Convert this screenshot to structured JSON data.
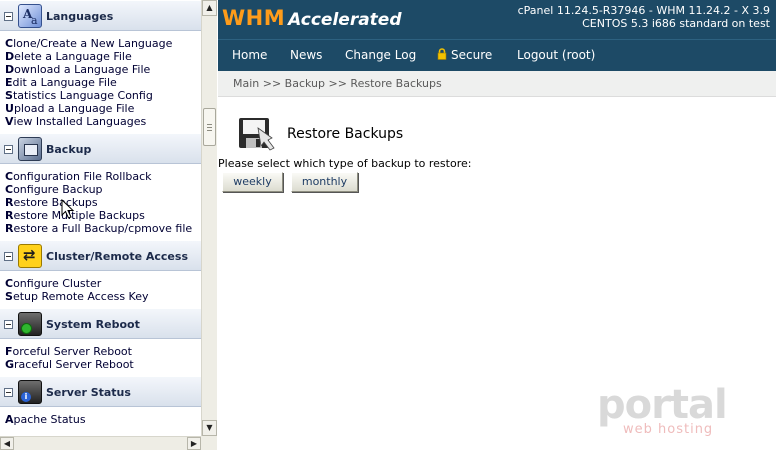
{
  "sidebar": {
    "sections": [
      {
        "title": "Languages",
        "icon": "language-icon",
        "links": [
          "Clone/Create a New Language",
          "Delete a Language File",
          "Download a Language File",
          "Edit a Language File",
          "Statistics Language Config",
          "Upload a Language File",
          "View Installed Languages"
        ]
      },
      {
        "title": "Backup",
        "icon": "backup-icon",
        "links": [
          "Configuration File Rollback",
          "Configure Backup",
          "Restore Backups",
          "Restore Multiple Backups",
          "Restore a Full Backup/cpmove file"
        ]
      },
      {
        "title": "Cluster/Remote Access",
        "icon": "cluster-icon",
        "links": [
          "Configure Cluster",
          "Setup Remote Access Key"
        ]
      },
      {
        "title": "System Reboot",
        "icon": "reboot-icon",
        "links": [
          "Forceful Server Reboot",
          "Graceful Server Reboot"
        ]
      },
      {
        "title": "Server Status",
        "icon": "server-status-icon",
        "links": [
          "Apache Status"
        ]
      }
    ]
  },
  "header": {
    "logo_main": "WHM",
    "logo_sub": "Accelerated",
    "version_line1": "cPanel 11.24.5-R37946 - WHM 11.24.2 - X 3.9",
    "version_line2": "CENTOS 5.3 i686 standard on test"
  },
  "nav": {
    "home": "Home",
    "news": "News",
    "changelog": "Change Log",
    "secure": "Secure",
    "logout": "Logout (root)"
  },
  "breadcrumb": "Main >> Backup >> Restore Backups",
  "main": {
    "title": "Restore Backups",
    "prompt": "Please select which type of backup to restore:",
    "buttons": [
      "weekly",
      "monthly"
    ]
  },
  "watermark": {
    "main": "portal",
    "sub": "web hosting"
  },
  "colors": {
    "header_bg": "#1d4a66",
    "logo_accent": "#ff9c1a",
    "breadcrumb_bg": "#eff0ef"
  }
}
